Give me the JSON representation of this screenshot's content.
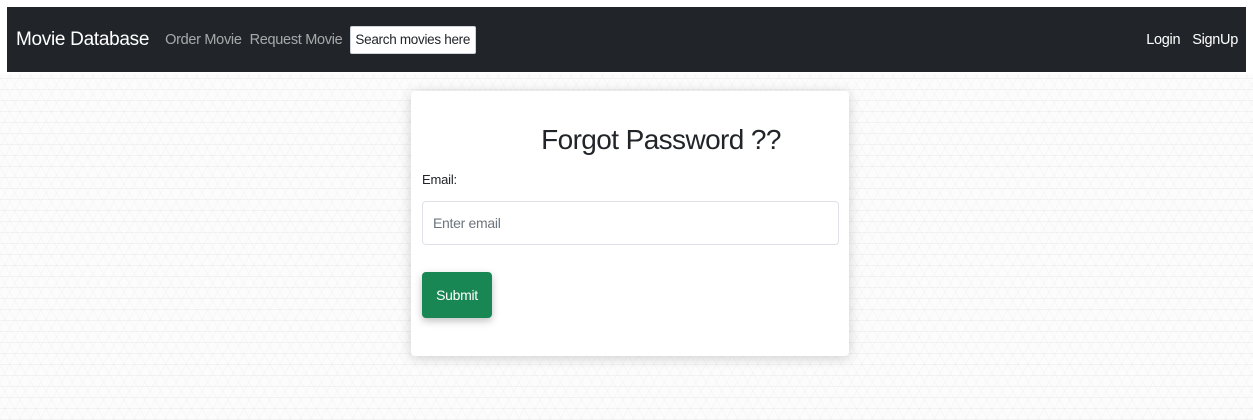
{
  "navbar": {
    "brand": "Movie Database",
    "links": [
      {
        "label": "Order Movie"
      },
      {
        "label": "Request Movie"
      }
    ],
    "search_placeholder": "Search movies here...",
    "right_links": [
      {
        "label": "Login"
      },
      {
        "label": "SignUp"
      }
    ]
  },
  "form": {
    "title": "Forgot Password ??",
    "email_label": "Email:",
    "email_placeholder": "Enter email",
    "email_value": "",
    "submit_label": "Submit"
  },
  "colors": {
    "navbar_bg": "#212529",
    "submit_bg": "#198754"
  }
}
